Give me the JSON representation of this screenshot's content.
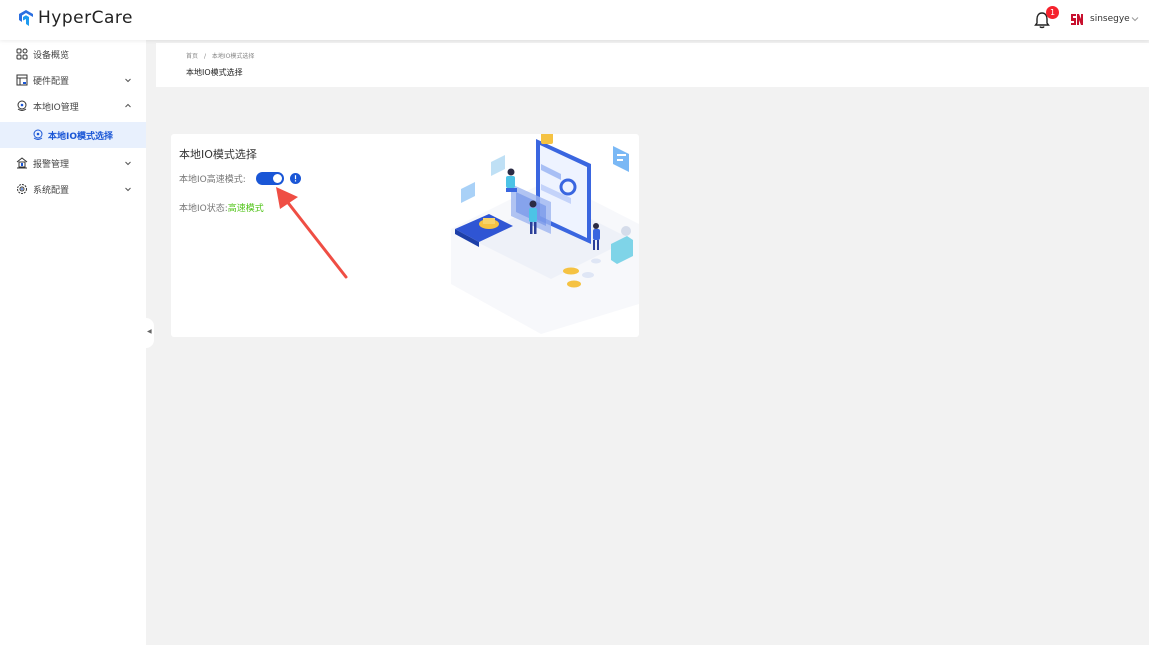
{
  "header": {
    "logo_text": "HyperCare",
    "notification_count": "1",
    "username": "sinsegye"
  },
  "sidebar": {
    "items": [
      {
        "label": "设备概览",
        "icon": "dashboard-icon"
      },
      {
        "label": "硬件配置",
        "icon": "hardware-icon"
      },
      {
        "label": "本地IO管理",
        "icon": "io-manage-icon"
      },
      {
        "label": "本地IO模式选择",
        "icon": "io-mode-icon"
      },
      {
        "label": "报警管理",
        "icon": "alarm-icon"
      },
      {
        "label": "系统配置",
        "icon": "settings-icon"
      }
    ]
  },
  "breadcrumb": {
    "home": "首页",
    "separator": "/",
    "current": "本地IO模式选择",
    "page_title": "本地IO模式选择"
  },
  "card": {
    "title": "本地IO模式选择",
    "speed_mode_label": "本地IO高速模式:",
    "speed_mode_on": true,
    "status_label": "本地IO状态:",
    "status_value": "高速模式"
  },
  "colors": {
    "primary": "#1a56d6",
    "success": "#52c41a",
    "badge": "#f5222d",
    "arrow": "#ef4e44"
  }
}
